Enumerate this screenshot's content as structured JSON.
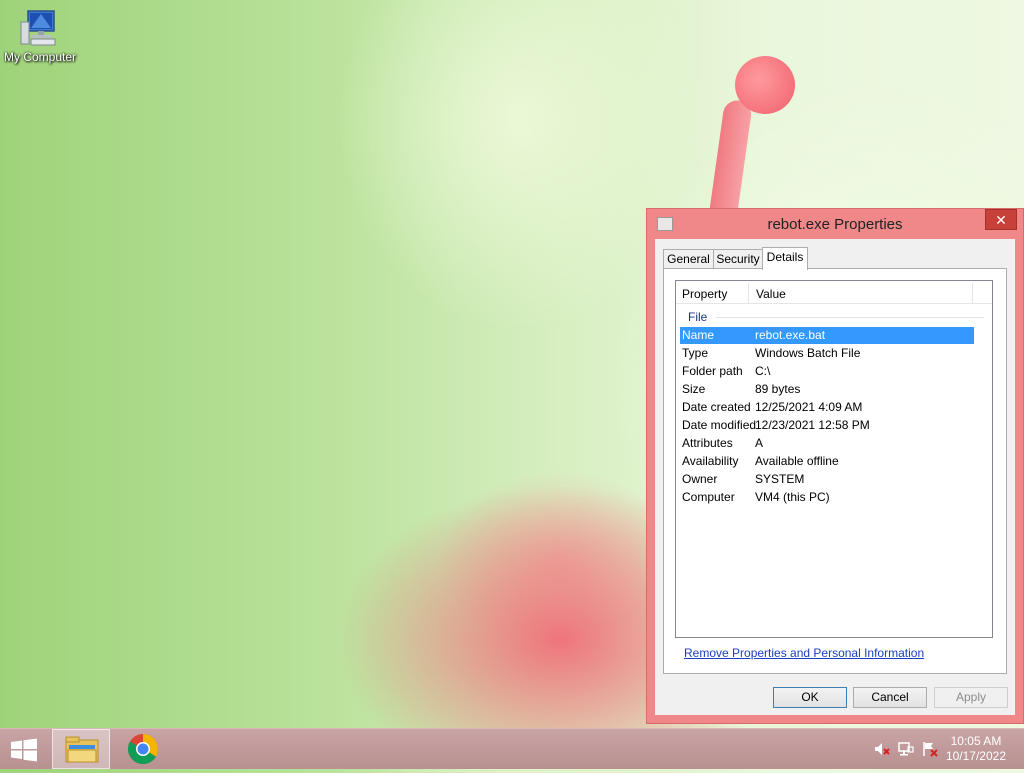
{
  "desktop": {
    "icons": [
      {
        "label": "My Computer",
        "icon": "computer-icon"
      }
    ]
  },
  "dialog": {
    "title": "rebot.exe Properties",
    "close_glyph": "✕",
    "tabs": [
      {
        "label": "General",
        "active": false
      },
      {
        "label": "Security",
        "active": false
      },
      {
        "label": "Details",
        "active": true
      }
    ],
    "columns": {
      "property": "Property",
      "value": "Value"
    },
    "group": "File",
    "rows": [
      {
        "k": "Name",
        "v": "rebot.exe.bat",
        "selected": true
      },
      {
        "k": "Type",
        "v": "Windows Batch File"
      },
      {
        "k": "Folder path",
        "v": "C:\\"
      },
      {
        "k": "Size",
        "v": "89 bytes"
      },
      {
        "k": "Date created",
        "v": "12/25/2021 4:09 AM"
      },
      {
        "k": "Date modified",
        "v": "12/23/2021 12:58 PM"
      },
      {
        "k": "Attributes",
        "v": "A"
      },
      {
        "k": "Availability",
        "v": "Available offline"
      },
      {
        "k": "Owner",
        "v": "SYSTEM"
      },
      {
        "k": "Computer",
        "v": "VM4 (this PC)"
      }
    ],
    "link": "Remove Properties and Personal Information",
    "buttons": {
      "ok": "OK",
      "cancel": "Cancel",
      "apply": "Apply"
    }
  },
  "taskbar": {
    "clock": {
      "time": "10:05 AM",
      "date": "10/17/2022"
    },
    "items": [
      "file-explorer-icon",
      "chrome-icon"
    ],
    "tray": [
      "volume-muted-icon",
      "network-icon",
      "action-center-flag-icon"
    ]
  },
  "colors": {
    "dialog_frame": "#f0888a",
    "selection": "#3399ff",
    "link": "#1a3fbf",
    "close": "#c7403a"
  }
}
